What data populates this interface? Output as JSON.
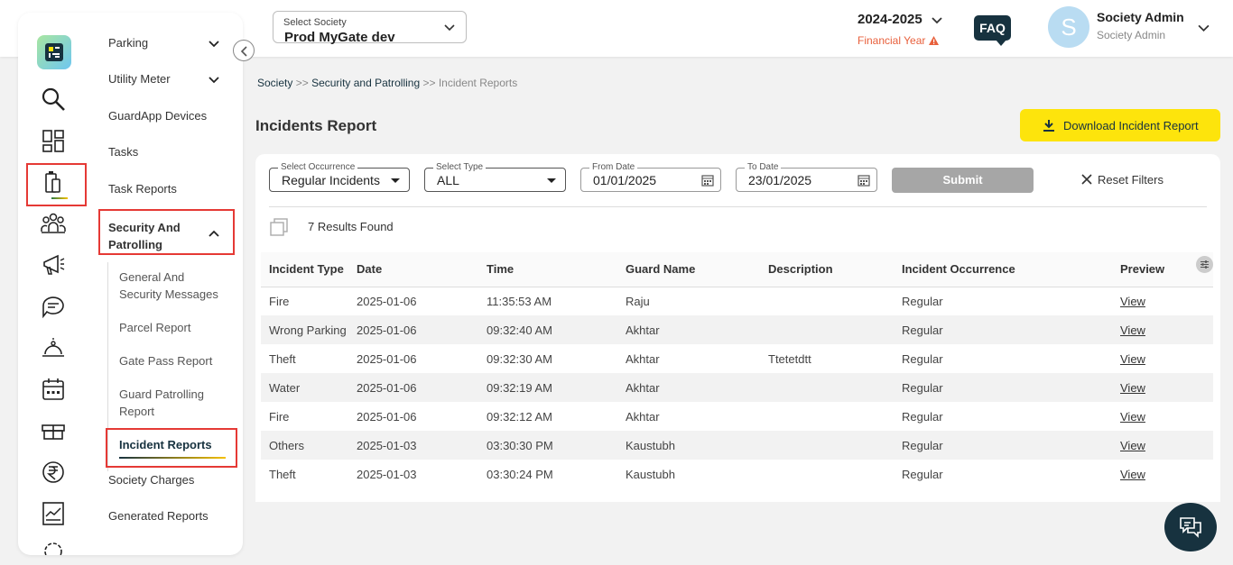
{
  "header": {
    "society_label": "Select Society",
    "society_value": "Prod MyGate dev",
    "year": "2024-2025",
    "financial_year_label": "Financial Year",
    "faq": "FAQ",
    "avatar_letter": "S",
    "user_name": "Society Admin",
    "user_role": "Society Admin"
  },
  "sidebar": {
    "items": [
      {
        "label": "Parking"
      },
      {
        "label": "Utility Meter"
      },
      {
        "label": "GuardApp Devices"
      },
      {
        "label": "Tasks"
      },
      {
        "label": "Task Reports"
      },
      {
        "label": "Security And Patrolling"
      },
      {
        "label": "Society Charges"
      },
      {
        "label": "Generated Reports"
      }
    ],
    "sub_items": [
      {
        "label": "General And Security Messages"
      },
      {
        "label": "Parcel Report"
      },
      {
        "label": "Gate Pass Report"
      },
      {
        "label": "Guard Patrolling Report"
      },
      {
        "label": "Incident Reports"
      }
    ],
    "rail_icons": [
      "search-icon",
      "dashboard-icon",
      "devices-icon",
      "people-icon",
      "announcement-icon",
      "chat-icon",
      "service-icon",
      "calendar-icon",
      "gift-icon",
      "rupee-icon",
      "chart-icon",
      "settings-icon"
    ]
  },
  "breadcrumb": {
    "society": "Society",
    "sep1": ">>",
    "security": "Security and Patrolling",
    "sep2": ">>",
    "current": "Incident Reports"
  },
  "page": {
    "title": "Incidents Report",
    "download_label": "Download Incident Report"
  },
  "filters": {
    "occurrence_label": "Select Occurrence",
    "occurrence_value": "Regular Incidents",
    "type_label": "Select Type",
    "type_value": "ALL",
    "from_label": "From Date",
    "from_value": "01/01/2025",
    "to_label": "To Date",
    "to_value": "23/01/2025",
    "submit_label": "Submit",
    "reset_label": "Reset Filters",
    "results_text": "7 Results Found"
  },
  "table": {
    "headers": [
      "Incident Type",
      "Date",
      "Time",
      "Guard Name",
      "Description",
      "Incident Occurrence",
      "Preview"
    ],
    "rows": [
      {
        "type": "Fire",
        "date": "2025-01-06",
        "time": "11:35:53 AM",
        "guard": "Raju",
        "desc": "",
        "occurrence": "Regular",
        "preview": "View"
      },
      {
        "type": "Wrong Parking",
        "date": "2025-01-06",
        "time": "09:32:40 AM",
        "guard": "Akhtar",
        "desc": "",
        "occurrence": "Regular",
        "preview": "View"
      },
      {
        "type": "Theft",
        "date": "2025-01-06",
        "time": "09:32:30 AM",
        "guard": "Akhtar",
        "desc": "Ttetetdtt",
        "occurrence": "Regular",
        "preview": "View"
      },
      {
        "type": "Water",
        "date": "2025-01-06",
        "time": "09:32:19 AM",
        "guard": "Akhtar",
        "desc": "",
        "occurrence": "Regular",
        "preview": "View"
      },
      {
        "type": "Fire",
        "date": "2025-01-06",
        "time": "09:32:12 AM",
        "guard": "Akhtar",
        "desc": "",
        "occurrence": "Regular",
        "preview": "View"
      },
      {
        "type": "Others",
        "date": "2025-01-03",
        "time": "03:30:30 PM",
        "guard": "Kaustubh",
        "desc": "",
        "occurrence": "Regular",
        "preview": "View"
      },
      {
        "type": "Theft",
        "date": "2025-01-03",
        "time": "03:30:24 PM",
        "guard": "Kaustubh",
        "desc": "",
        "occurrence": "Regular",
        "preview": "View"
      }
    ]
  },
  "colors": {
    "accent": "#fde40c",
    "dark": "#17323f",
    "highlight": "#e53935",
    "warning": "#e8603c"
  }
}
